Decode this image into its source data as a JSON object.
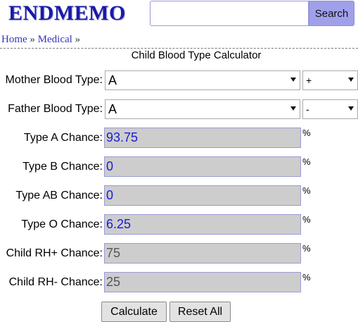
{
  "header": {
    "logo": "ENDMEMO",
    "search_value": "",
    "search_button": "Search"
  },
  "breadcrumb": {
    "home": "Home",
    "sep1": "»",
    "section": "Medical",
    "sep2": "»"
  },
  "page_title": "Child Blood Type Calculator",
  "form": {
    "mother": {
      "label": "Mother Blood Type:",
      "type": "A",
      "rh": "+"
    },
    "father": {
      "label": "Father Blood Type:",
      "type": "A",
      "rh": "-"
    }
  },
  "results": [
    {
      "label": "Type A Chance:",
      "value": "93.75",
      "unit": "%"
    },
    {
      "label": "Type B Chance:",
      "value": "0",
      "unit": "%"
    },
    {
      "label": "Type AB Chance:",
      "value": "0",
      "unit": "%"
    },
    {
      "label": "Type O Chance:",
      "value": "6.25",
      "unit": "%"
    },
    {
      "label": "Child RH+ Chance:",
      "value": "75",
      "unit": "%"
    },
    {
      "label": "Child RH- Chance:",
      "value": "25",
      "unit": "%"
    }
  ],
  "buttons": {
    "calculate": "Calculate",
    "reset": "Reset All"
  },
  "colors": {
    "logo": "#1a1aa6",
    "search_button": "#a0a0ea",
    "result_text": "#1a1ad6",
    "result_bg": "#cdcdcd"
  }
}
